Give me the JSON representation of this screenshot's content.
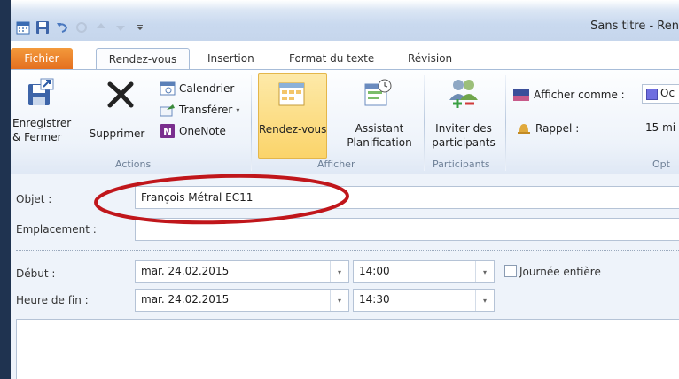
{
  "title": "Sans titre - Ren",
  "tabs": [
    "Fichier",
    "Rendez-vous",
    "Insertion",
    "Format du texte",
    "Révision"
  ],
  "ribbon": {
    "save_close": [
      "Enregistrer",
      "& Fermer"
    ],
    "delete": "Supprimer",
    "calendar": "Calendrier",
    "forward": "Transférer",
    "onenote": "OneNote",
    "group_actions": "Actions",
    "appointment": "Rendez-vous",
    "scheduling": [
      "Assistant",
      "Planification"
    ],
    "group_show": "Afficher",
    "invite": [
      "Inviter des",
      "participants"
    ],
    "group_participants": "Participants",
    "show_as_label": "Afficher comme :",
    "show_as_value": "Oc",
    "reminder_label": "Rappel :",
    "reminder_value": "15 mi",
    "group_options": "Opt"
  },
  "form": {
    "subject_label": "Objet :",
    "subject_value": "François Métral EC11",
    "location_label": "Emplacement :",
    "location_value": "",
    "start_label": "Début :",
    "start_date": "mar. 24.02.2015",
    "start_time": "14:00",
    "allday_label": "Journée entière",
    "end_label": "Heure de fin :",
    "end_date": "mar. 24.02.2015",
    "end_time": "14:30"
  },
  "colors": {
    "file_tab": "#e46f1f",
    "annotation": "#c0161b",
    "selected_button": "#fbd86a"
  }
}
